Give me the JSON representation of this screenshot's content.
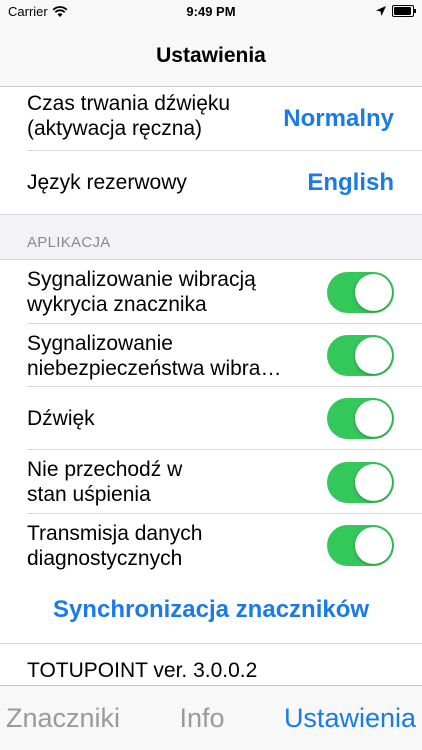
{
  "status_bar": {
    "carrier": "Carrier",
    "time": "9:49 PM"
  },
  "nav": {
    "title": "Ustawienia"
  },
  "rows_top": [
    {
      "label": "Czas trwania dźwięku\n(aktywacja ręczna)",
      "value": "Normalny"
    },
    {
      "label": "Język rezerwowy",
      "value": "English"
    }
  ],
  "section_app": {
    "header": "APLIKACJA"
  },
  "toggles": [
    {
      "label": "Sygnalizowanie wibracją\nwykrycia znacznika",
      "on": true
    },
    {
      "label": "Sygnalizowanie\nniebezpieczeństwa wibra…",
      "on": true
    },
    {
      "label": "Dźwięk",
      "on": true
    },
    {
      "label": "Nie przechodź w\nstan uśpienia",
      "on": true
    },
    {
      "label": "Transmisja danych\ndiagnostycznych",
      "on": true
    }
  ],
  "sync_button": "Synchronizacja znaczników",
  "version": "TOTUPOINT ver. 3.0.0.2",
  "tabs": [
    {
      "label": "Znaczniki",
      "active": false
    },
    {
      "label": "Info",
      "active": false
    },
    {
      "label": "Ustawienia",
      "active": true
    }
  ],
  "colors": {
    "accent": "#1a7be8",
    "toggle_on": "#34c759",
    "section_header": "#8a8a8e"
  }
}
